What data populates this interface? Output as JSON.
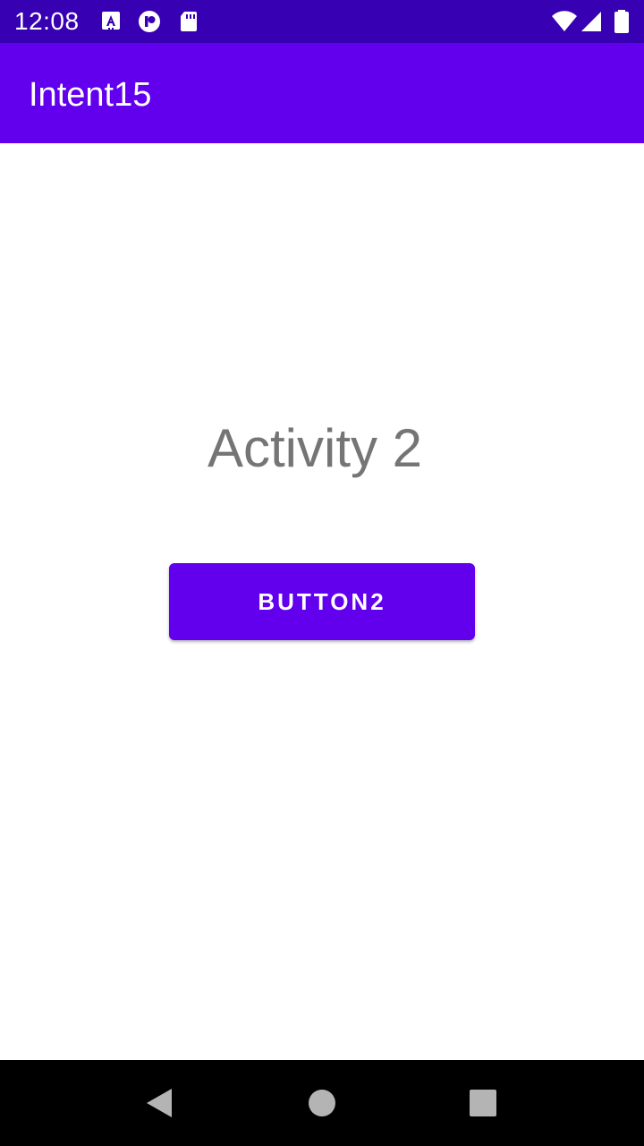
{
  "status_bar": {
    "time": "12:08",
    "background_color": "#3700b3",
    "left_icons": [
      "accessibility-a-icon",
      "record-icon",
      "sd-card-icon"
    ],
    "right_icons": [
      "wifi-icon",
      "cell-signal-icon",
      "battery-icon"
    ]
  },
  "app_bar": {
    "title": "Intent15",
    "background_color": "#6200ee"
  },
  "main": {
    "activity_label": "Activity 2",
    "button_label": "BUTTON2",
    "button_color": "#6200ee",
    "label_color": "#757575"
  },
  "nav_bar": {
    "buttons": [
      "back-icon",
      "home-icon",
      "recents-icon"
    ]
  }
}
